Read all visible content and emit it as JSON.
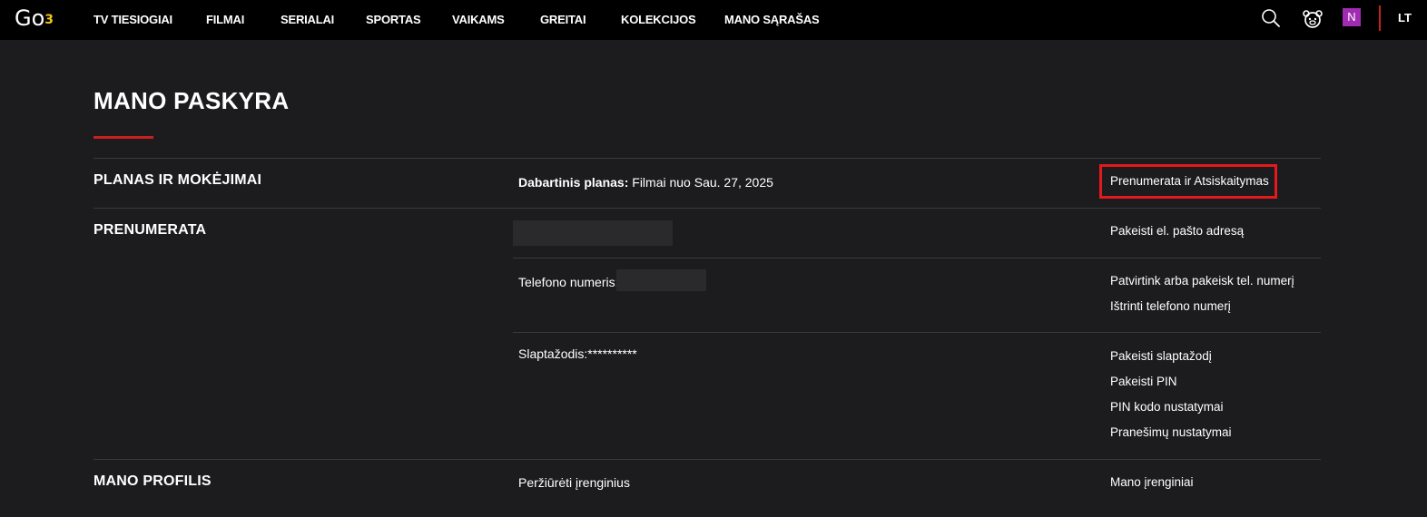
{
  "header": {
    "logo_text": "Go",
    "logo_superscript": "3",
    "nav": [
      "TV TIESIOGIAI",
      "FILMAI",
      "SERIALAI",
      "SPORTAS",
      "VAIKAMS",
      "GREITAI",
      "KOLEKCIJOS",
      "MANO SĄRAŠAS"
    ],
    "profile_initial": "N",
    "language": "LT",
    "icons": [
      "search-icon",
      "kids-icon",
      "profile-icon"
    ]
  },
  "page": {
    "title": "MANO PASKYRA"
  },
  "sections": {
    "plan": {
      "label": "PLANAS IR MOKĖJIMAI",
      "current_plan_label": "Dabartinis planas:",
      "current_plan_value": " Filmai nuo Sau. 27, 2025",
      "link": "Prenumerata ir Atsiskaitymas"
    },
    "subscription": {
      "label": "PRENUMERATA",
      "email_link": "Pakeisti el. pašto adresą",
      "phone_label": "Telefono numeris:",
      "phone_links": [
        "Patvirtink arba pakeisk tel. numerį",
        "Ištrinti telefono numerį"
      ],
      "password_label": "Slaptažodis:**********",
      "password_links": [
        "Pakeisti slaptažodį",
        "Pakeisti PIN",
        "PIN kodo nustatymai",
        "Pranešimų nustatymai"
      ]
    },
    "profile": {
      "label": "MANO PROFILIS",
      "devices_text": "Peržiūrėti įrenginius",
      "devices_link": "Mano įrenginiai"
    }
  },
  "colors": {
    "background": "#1c1c1e",
    "topbar": "#000000",
    "accent_red": "#c81f1f",
    "highlight_red": "#e3191c",
    "profile_purple": "#a12bb3",
    "divider": "#3a3a3c"
  }
}
